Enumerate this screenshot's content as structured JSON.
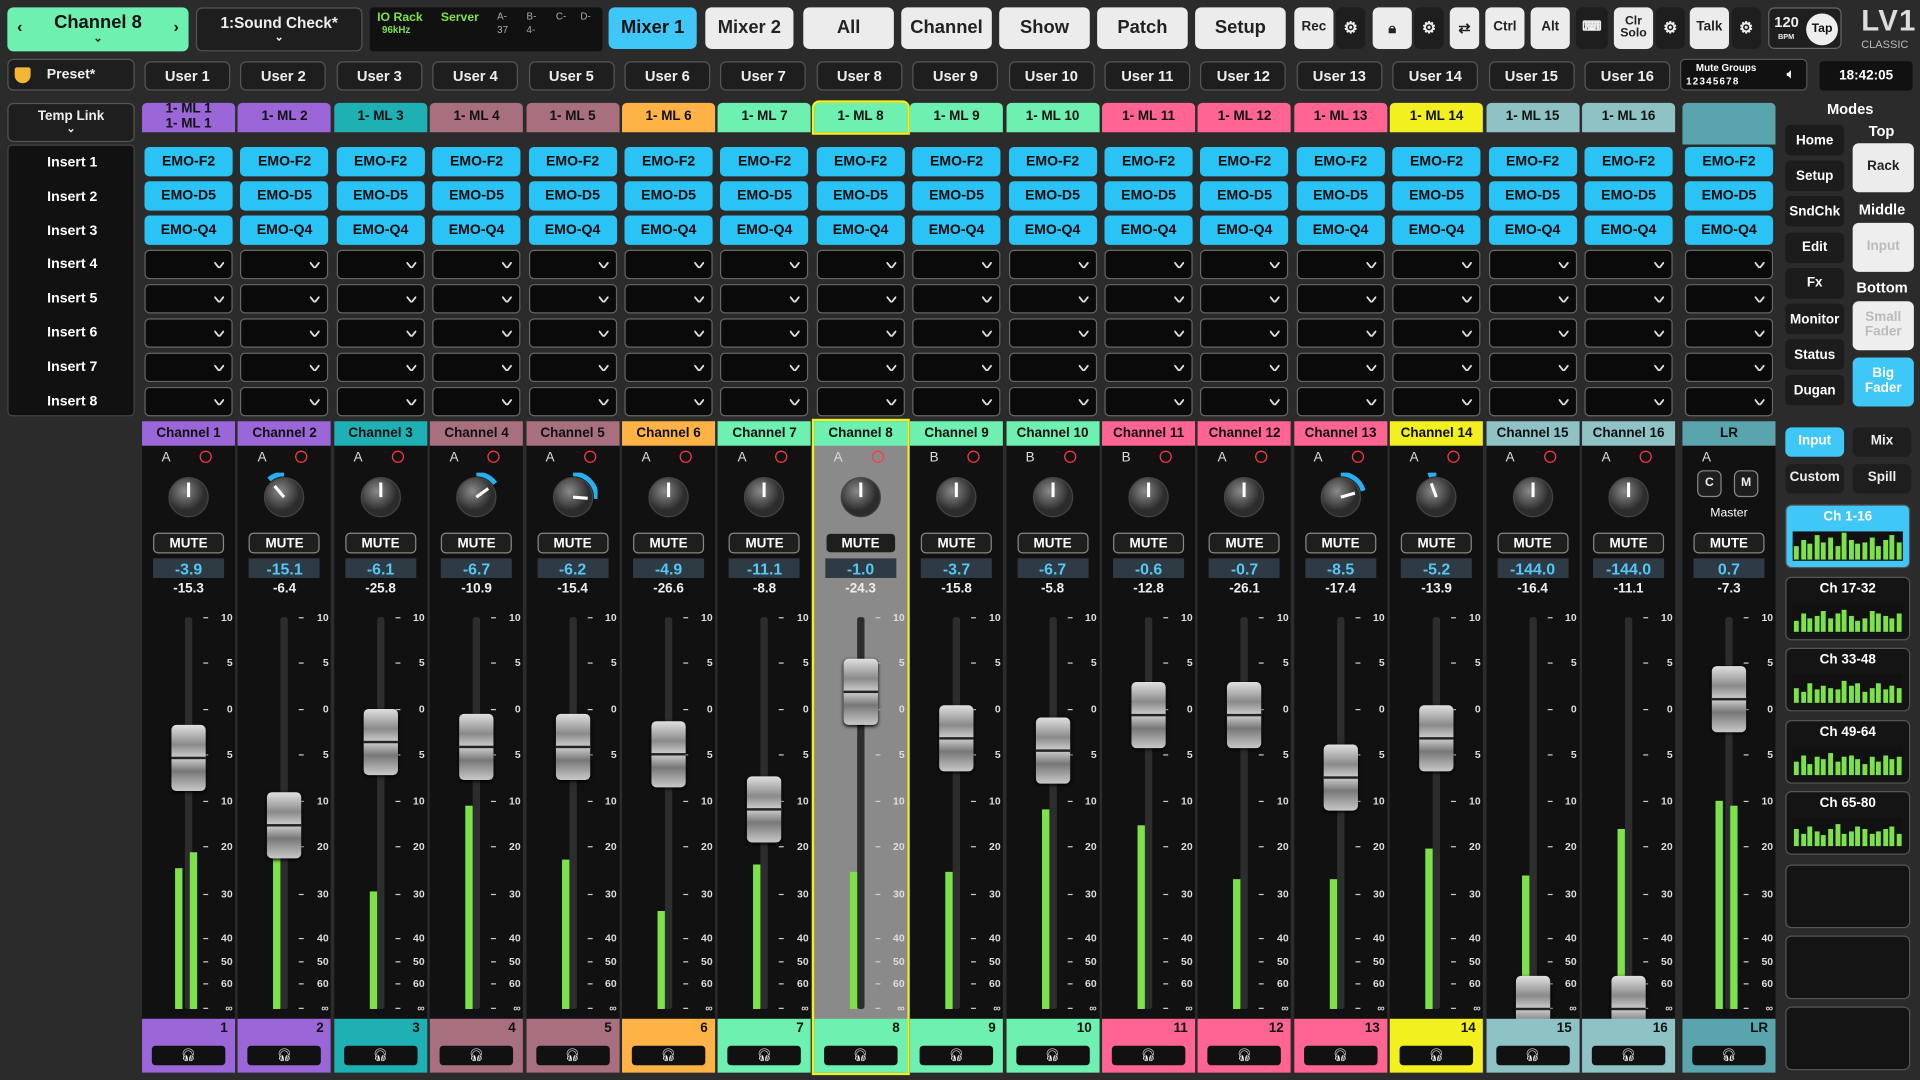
{
  "top": {
    "channel_selector": "Channel 8",
    "show_name": "1:Sound Check*",
    "io_rack": "IO Rack",
    "sample_rate": "96kHz",
    "server": "Server",
    "io_cells": [
      "A-",
      "B-",
      "C-",
      "D-",
      "37",
      "4-"
    ],
    "nav": [
      "Mixer 1",
      "Mixer 2",
      "All",
      "Channel",
      "Show",
      "Patch",
      "Setup"
    ],
    "rec": "Rec",
    "ctrl": "Ctrl",
    "alt": "Alt",
    "clr_solo_1": "Clr",
    "clr_solo_2": "Solo",
    "talk": "Talk",
    "bpm": "120",
    "bpm_unit": "BPM",
    "tap": "Tap",
    "logo": "LV1",
    "logo_sub": "CLASSIC"
  },
  "second": {
    "preset": "Preset*",
    "users": [
      "User 1",
      "User 2",
      "User 3",
      "User 4",
      "User 5",
      "User 6",
      "User 7",
      "User 8",
      "User 9",
      "User 10",
      "User 11",
      "User 12",
      "User 13",
      "User 14",
      "User 15",
      "User 16"
    ],
    "mute_groups": "Mute Groups",
    "mute_group_numbers": "12345678",
    "clock": "18:42:05"
  },
  "left": {
    "temp_link": "Temp Link",
    "inserts": [
      "Insert 1",
      "Insert 2",
      "Insert 3",
      "Insert 4",
      "Insert 5",
      "Insert 6",
      "Insert 7",
      "Insert 8"
    ]
  },
  "plugins": [
    "EMO-F2",
    "EMO-D5",
    "EMO-Q4"
  ],
  "colors": {
    "purple": "#9a66d8",
    "teal": "#1fb0b4",
    "mauve": "#a8707e",
    "orange": "#ffb347",
    "mint": "#6ef0b0",
    "pink": "#ff6492",
    "yellow": "#f3f020",
    "grey": "#8fc2c4",
    "lr": "#5aa4ae"
  },
  "channels": [
    {
      "scribble": [
        "1- ML 1",
        "1- ML 1"
      ],
      "name": "Channel 1",
      "color": "#9a66d8",
      "bank": "A",
      "gain": "-3.9",
      "peak": "-15.3",
      "fader": 0.64,
      "meter": 0.36,
      "meter2": 0.4,
      "num": "1",
      "pan": 0
    },
    {
      "scribble": [
        "1- ML 2"
      ],
      "name": "Channel 2",
      "color": "#9a66d8",
      "bank": "A",
      "gain": "-15.1",
      "peak": "-6.4",
      "fader": 0.47,
      "meter": 0.4,
      "meter2": 0,
      "num": "2",
      "pan": -0.3
    },
    {
      "scribble": [
        "1- ML 3"
      ],
      "name": "Channel 3",
      "color": "#1fb0b4",
      "bank": "A",
      "gain": "-6.1",
      "peak": "-25.8",
      "fader": 0.68,
      "meter": 0.3,
      "meter2": 0,
      "num": "3",
      "pan": 0
    },
    {
      "scribble": [
        "1- ML 4"
      ],
      "name": "Channel 4",
      "color": "#a8707e",
      "bank": "A",
      "gain": "-6.7",
      "peak": "-10.9",
      "fader": 0.67,
      "meter": 0.52,
      "meter2": 0,
      "num": "4",
      "pan": 0.4
    },
    {
      "scribble": [
        "1- ML 5"
      ],
      "name": "Channel 5",
      "color": "#a8707e",
      "bank": "A",
      "gain": "-6.2",
      "peak": "-15.4",
      "fader": 0.67,
      "meter": 0.38,
      "meter2": 0,
      "num": "5",
      "pan": 0.7
    },
    {
      "scribble": [
        "1- ML 6"
      ],
      "name": "Channel 6",
      "color": "#ffb347",
      "bank": "A",
      "gain": "-4.9",
      "peak": "-26.6",
      "fader": 0.65,
      "meter": 0.25,
      "meter2": 0,
      "num": "6",
      "pan": 0
    },
    {
      "scribble": [
        "1- ML 7"
      ],
      "name": "Channel 7",
      "color": "#6ef0b0",
      "bank": "A",
      "gain": "-11.1",
      "peak": "-8.8",
      "fader": 0.51,
      "meter": 0.37,
      "meter2": 0,
      "num": "7",
      "pan": 0
    },
    {
      "scribble": [
        "1- ML 8"
      ],
      "name": "Channel 8",
      "color": "#6ef0b0",
      "bank": "A",
      "gain": "-1.0",
      "peak": "-24.3",
      "fader": 0.81,
      "meter": 0.35,
      "meter2": 0,
      "num": "8",
      "pan": 0,
      "selected": true
    },
    {
      "scribble": [
        "1- ML 9"
      ],
      "name": "Channel 9",
      "color": "#6ef0b0",
      "bank": "B",
      "gain": "-3.7",
      "peak": "-15.8",
      "fader": 0.69,
      "meter": 0.35,
      "meter2": 0,
      "num": "9",
      "pan": 0
    },
    {
      "scribble": [
        "1- ML 10"
      ],
      "name": "Channel 10",
      "color": "#6ef0b0",
      "bank": "B",
      "gain": "-6.7",
      "peak": "-5.8",
      "fader": 0.66,
      "meter": 0.51,
      "meter2": 0,
      "num": "10",
      "pan": 0
    },
    {
      "scribble": [
        "1- ML 11"
      ],
      "name": "Channel 11",
      "color": "#ff6492",
      "bank": "B",
      "gain": "-0.6",
      "peak": "-12.8",
      "fader": 0.75,
      "meter": 0.47,
      "meter2": 0,
      "num": "11",
      "pan": 0
    },
    {
      "scribble": [
        "1- ML 12"
      ],
      "name": "Channel 12",
      "color": "#ff6492",
      "bank": "A",
      "gain": "-0.7",
      "peak": "-26.1",
      "fader": 0.75,
      "meter": 0.33,
      "meter2": 0,
      "num": "12",
      "pan": 0
    },
    {
      "scribble": [
        "1- ML 13"
      ],
      "name": "Channel 13",
      "color": "#ff6492",
      "bank": "A",
      "gain": "-8.5",
      "peak": "-17.4",
      "fader": 0.59,
      "meter": 0.33,
      "meter2": 0,
      "num": "13",
      "pan": 0.55
    },
    {
      "scribble": [
        "1- ML 14"
      ],
      "name": "Channel 14",
      "color": "#f3f020",
      "bank": "A",
      "gain": "-5.2",
      "peak": "-13.9",
      "fader": 0.69,
      "meter": 0.41,
      "meter2": 0,
      "num": "14",
      "pan": -0.15
    },
    {
      "scribble": [
        "1- ML 15"
      ],
      "name": "Channel 15",
      "color": "#8fc2c4",
      "bank": "A",
      "gain": "-144.0",
      "peak": "-16.4",
      "fader": 0.0,
      "meter": 0.34,
      "meter2": 0,
      "num": "15",
      "pan": 0
    },
    {
      "scribble": [
        "1- ML 16"
      ],
      "name": "Channel 16",
      "color": "#8fc2c4",
      "bank": "A",
      "gain": "-144.0",
      "peak": "-11.1",
      "fader": 0.0,
      "meter": 0.46,
      "meter2": 0,
      "num": "16",
      "pan": 0
    }
  ],
  "lr": {
    "name": "LR",
    "bank": "A",
    "c": "C",
    "m": "M",
    "master": "Master",
    "mute": "MUTE",
    "gain": "0.7",
    "peak": "-7.3",
    "fader": 0.79,
    "meter": 0.53,
    "meter2": 0.52,
    "num": "LR"
  },
  "mute_label": "MUTE",
  "scale": [
    "10",
    "5",
    "0",
    "5",
    "10",
    "20",
    "30",
    "40",
    "50",
    "60",
    "∞"
  ],
  "right": {
    "modes": "Modes",
    "top": "Top",
    "middle": "Middle",
    "bottom": "Bottom",
    "buttons": [
      "Home",
      "Setup",
      "SndChk",
      "Edit",
      "Fx",
      "Monitor",
      "Status",
      "Dugan"
    ],
    "rack": "Rack",
    "input_mid": "Input",
    "small_fader_1": "Small",
    "small_fader_2": "Fader",
    "big_fader_1": "Big",
    "big_fader_2": "Fader",
    "input": "Input",
    "mix": "Mix",
    "custom": "Custom",
    "spill": "Spill",
    "banks": [
      "Ch 1-16",
      "Ch 17-32",
      "Ch 33-48",
      "Ch 49-64",
      "Ch 65-80"
    ]
  }
}
